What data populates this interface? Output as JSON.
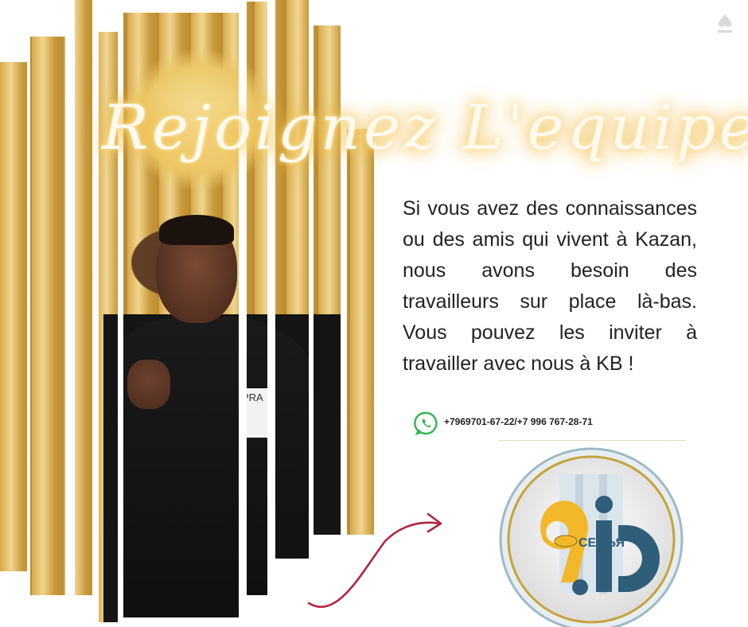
{
  "poster": {
    "title": "Rejoignez L'equipe",
    "body": "Si vous avez des connaissances ou des amis qui vivent à Kazan, nous avons besoin des travailleurs sur place là-bas. Vous pouvez les inviter à travailler avec nous à KB !",
    "contact": {
      "icon": "whatsapp-icon",
      "phones": "+7969701-67-22/+7 996 767-28-71"
    },
    "photo_tag_text": "PRA",
    "logo": {
      "text": "СЕМЬЯ",
      "icon": "handshake-icon"
    }
  },
  "colors": {
    "gold": "#d9ad4f",
    "glow": "#f6c85a",
    "arrow": "#b0253f",
    "logo_blue": "#2f5e7a",
    "logo_yellow": "#f2b82a",
    "text": "#222222"
  }
}
